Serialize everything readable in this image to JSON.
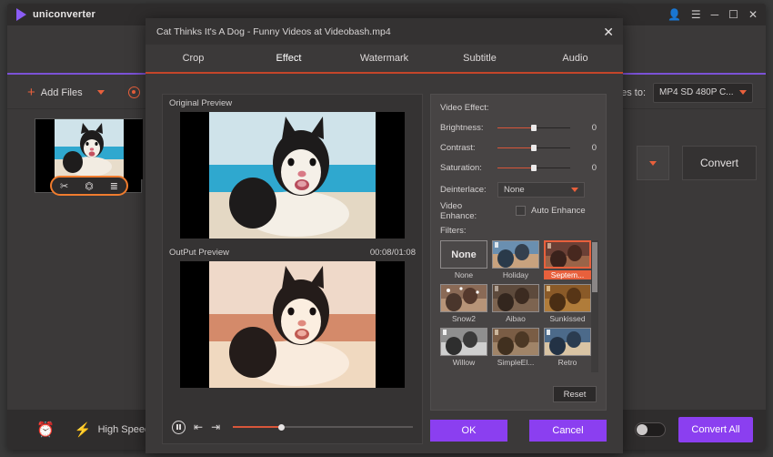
{
  "app": {
    "name": "uniconverter",
    "titlebar_icons": [
      "account-icon",
      "menu-icon",
      "minimize-icon",
      "maximize-icon",
      "close-icon"
    ]
  },
  "toolbar": {
    "add_files": "Add Files",
    "load_dvd": "Load",
    "convert_all_to_label": "ll files to:",
    "format_value": "MP4 SD 480P C..."
  },
  "file_card": {
    "edit_icons": [
      "trim-icon",
      "crop-icon",
      "effect-icon"
    ]
  },
  "right_panel": {
    "convert_button": "Convert"
  },
  "statusbar": {
    "clock_icon": "scheduler-icon",
    "bolt_icon": "high-speed-icon",
    "high_speed_label": "High Speed Convers",
    "convert_all": "Convert All"
  },
  "dialog": {
    "title": "Cat Thinks It's A Dog - Funny Videos at Videobash.mp4",
    "close_label": "✕",
    "tabs": [
      {
        "label": "Crop",
        "active": false
      },
      {
        "label": "Effect",
        "active": true
      },
      {
        "label": "Watermark",
        "active": false
      },
      {
        "label": "Subtitle",
        "active": false
      },
      {
        "label": "Audio",
        "active": false
      }
    ],
    "preview": {
      "original_label": "Original Preview",
      "output_label": "OutPut Preview",
      "time": "00:08/01:08",
      "controls": [
        "pause-icon",
        "previous-frame-icon",
        "next-frame-icon"
      ]
    },
    "settings": {
      "section_label": "Video Effect:",
      "rows": [
        {
          "label": "Brightness:",
          "value": "0"
        },
        {
          "label": "Contrast:",
          "value": "0"
        },
        {
          "label": "Saturation:",
          "value": "0"
        }
      ],
      "deinterlace_label": "Deinterlace:",
      "deinterlace_value": "None",
      "video_enhance_label": "Video Enhance:",
      "auto_enhance_label": "Auto Enhance",
      "auto_enhance_checked": false,
      "filters_label": "Filters:",
      "filters": [
        {
          "name": "None",
          "selected": false,
          "is_none": true
        },
        {
          "name": "Holiday",
          "selected": false,
          "is_none": false
        },
        {
          "name": "Septem...",
          "selected": true,
          "is_none": false
        },
        {
          "name": "Snow2",
          "selected": false,
          "is_none": false
        },
        {
          "name": "Aibao",
          "selected": false,
          "is_none": false
        },
        {
          "name": "Sunkissed",
          "selected": false,
          "is_none": false
        },
        {
          "name": "Willow",
          "selected": false,
          "is_none": false
        },
        {
          "name": "SimpleEl...",
          "selected": false,
          "is_none": false
        },
        {
          "name": "Retro",
          "selected": false,
          "is_none": false
        }
      ],
      "reset_label": "Reset"
    },
    "ok_label": "OK",
    "cancel_label": "Cancel"
  },
  "colors": {
    "accent_orange": "#e8603c",
    "accent_purple": "#8b3ff0",
    "tab_underline": "#c4452a",
    "window_bg": "#3b3939"
  }
}
